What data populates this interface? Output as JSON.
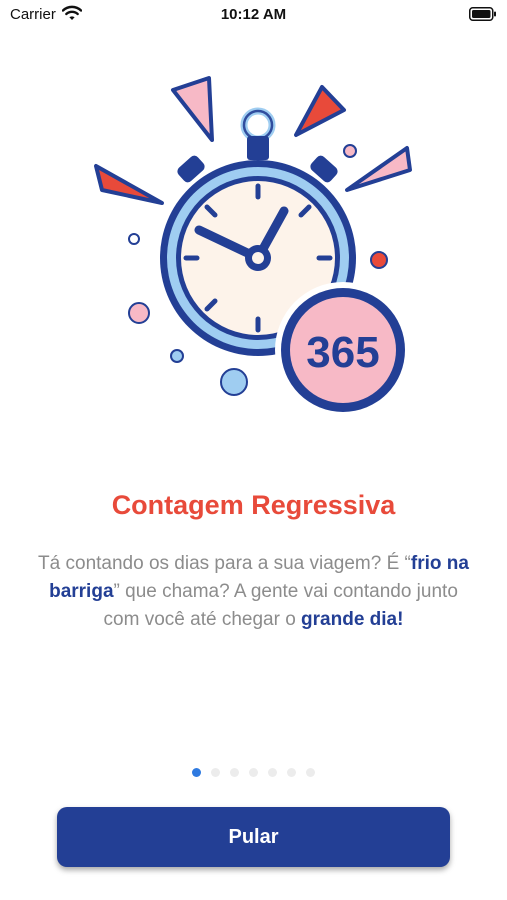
{
  "status_bar": {
    "carrier": "Carrier",
    "time": "10:12 AM",
    "icons": [
      "wifi-icon",
      "battery-icon"
    ]
  },
  "illustration": {
    "icon": "stopwatch-countdown-illustration",
    "badge_number": "365",
    "colors": {
      "navy": "#233f95",
      "light_blue": "#9fcdf1",
      "pink": "#f7b9c6",
      "red": "#e84a3a",
      "cream": "#fdf3ea"
    }
  },
  "onboarding": {
    "title": "Contagem Regressiva",
    "description": {
      "part1": "Tá contando os dias para a sua viagem? É “",
      "highlight1": "frio na barriga",
      "part2": "” que chama? A gente vai contando junto com você até chegar o ",
      "highlight2": "grande dia!"
    }
  },
  "page_indicator": {
    "total": 7,
    "active_index": 0
  },
  "skip_button": {
    "label": "Pular"
  },
  "colors": {
    "title": "#e84a3a",
    "body_text": "#8c8c8c",
    "highlight": "#233f95",
    "button_bg": "#233f95",
    "dot_active": "#2f7ae0",
    "dot_inactive": "#ececec"
  }
}
